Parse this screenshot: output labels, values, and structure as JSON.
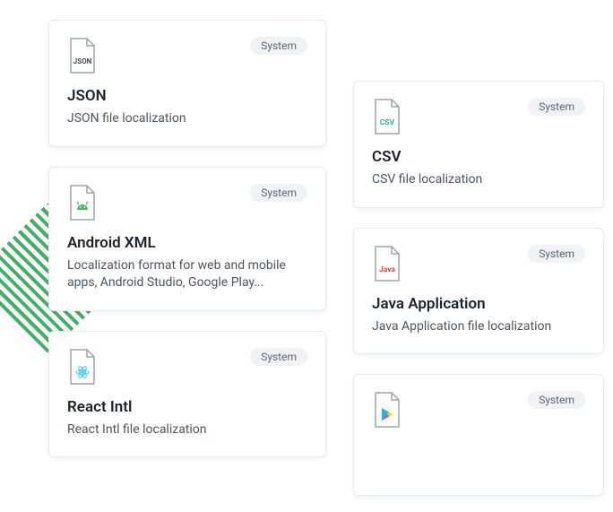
{
  "badge_label": "System",
  "cards": {
    "json": {
      "title": "JSON",
      "desc": "JSON file localization",
      "icon_label": "JSON",
      "icon_color": "#2c3e50"
    },
    "androidxml": {
      "title": "Android XML",
      "desc": "Localization format for web and mobile apps, Android Studio, Google Play...",
      "icon_color": "#3ac15a"
    },
    "reactintl": {
      "title": "React Intl",
      "desc": "React Intl file localization",
      "icon_color": "#45c7ef"
    },
    "csv": {
      "title": "CSV",
      "desc": "CSV file localization",
      "icon_label": "CSV",
      "icon_color": "#1aa99c"
    },
    "java": {
      "title": "Java Application",
      "desc": "Java Application file localization",
      "icon_label": "Java",
      "icon_color": "#e6332a"
    },
    "play": {
      "icon_color_a": "#19b3ff",
      "icon_color_b": "#ffcd00",
      "icon_color_c": "#ff4757",
      "icon_color_d": "#2ecc71"
    }
  }
}
